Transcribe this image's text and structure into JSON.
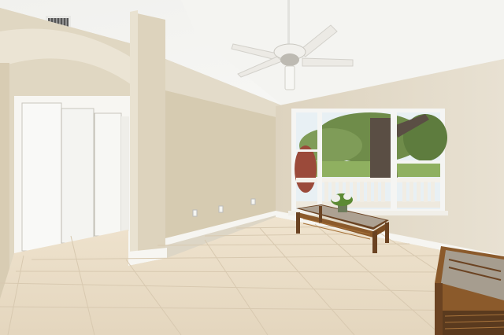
{
  "scene": {
    "description_type": "interior-room-photo",
    "colors": {
      "ceiling": "#f3f2ee",
      "wall_left": "#ddd3bd",
      "wall_center": "#d9cfb6",
      "wall_right": "#e2dac8",
      "floor": "#ece0cb",
      "trim": "#f7f6f2",
      "door": "#f9f9f7",
      "wood": "#8b5a2b",
      "glass": "#b8b2a6",
      "sky": "#e8f0f4",
      "foliage": "#6f8c4a",
      "trunk": "#5a4e44"
    },
    "icons": {
      "fan": "ceiling-fan-icon",
      "vent": "air-vent-icon"
    }
  }
}
